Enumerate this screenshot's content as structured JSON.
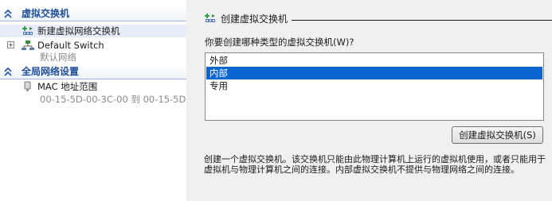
{
  "sidebar": {
    "sections": [
      {
        "title": "虚拟交换机",
        "chevron_icon": "double-chevron-up-icon"
      },
      {
        "title": "全局网络设置",
        "chevron_icon": "double-chevron-up-icon"
      }
    ],
    "items": [
      {
        "label": "新建虚拟网络交换机",
        "icon": "new-switch-icon"
      },
      {
        "label": "Default Switch",
        "sublabel": "默认网络",
        "icon": "network-switch-icon",
        "expand_glyph": "+"
      },
      {
        "label": "MAC 地址范围",
        "sublabel": "00-15-5D-00-3C-00 到 00-15-5D-0...",
        "icon": "mac-address-icon"
      }
    ]
  },
  "main": {
    "header_title": "创建虚拟交换机",
    "header_icon": "new-switch-icon",
    "question": "你要创建哪种类型的虚拟交换机(W)?",
    "switch_types": [
      "外部",
      "内部",
      "专用"
    ],
    "selected_type": "内部",
    "create_button": "创建虚拟交换机(S)",
    "description": "创建一个虚拟交换机。该交换机只能由此物理计算机上运行的虚拟机使用，或者只能用于虚拟机与物理计算机之间的连接。内部虚拟交换机不提供与物理网络之间的连接。"
  },
  "colors": {
    "section_title": "#1f4e96",
    "selection": "#0a64d2",
    "pane_background": "#f0f0f0"
  }
}
